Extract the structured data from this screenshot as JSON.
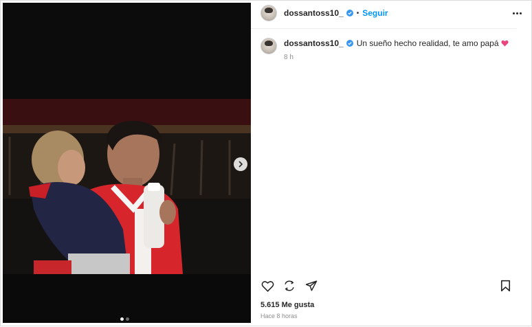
{
  "post": {
    "author": {
      "username": "dossantoss10_",
      "verified": true,
      "follow_label": "Seguir",
      "separator": "•"
    },
    "caption": {
      "text": "Un sueño hecho realidad, te amo papá",
      "emoji": "pink-heart",
      "time": "8 h"
    },
    "media": {
      "slides": 2,
      "current_slide": 1,
      "next_icon": "chevron-right-icon"
    },
    "actions": {
      "like_icon": "heart-outline-icon",
      "comment_icon": "comment-icon",
      "share_icon": "paper-plane-icon",
      "save_icon": "bookmark-icon"
    },
    "likes": "5.615 Me gusta",
    "posted": "Hace 8 horas"
  },
  "colors": {
    "accent": "#0095f6",
    "verified": "#3897f0",
    "heart_emoji": "#e8467c",
    "text": "#262626",
    "muted": "#8e8e8e"
  }
}
